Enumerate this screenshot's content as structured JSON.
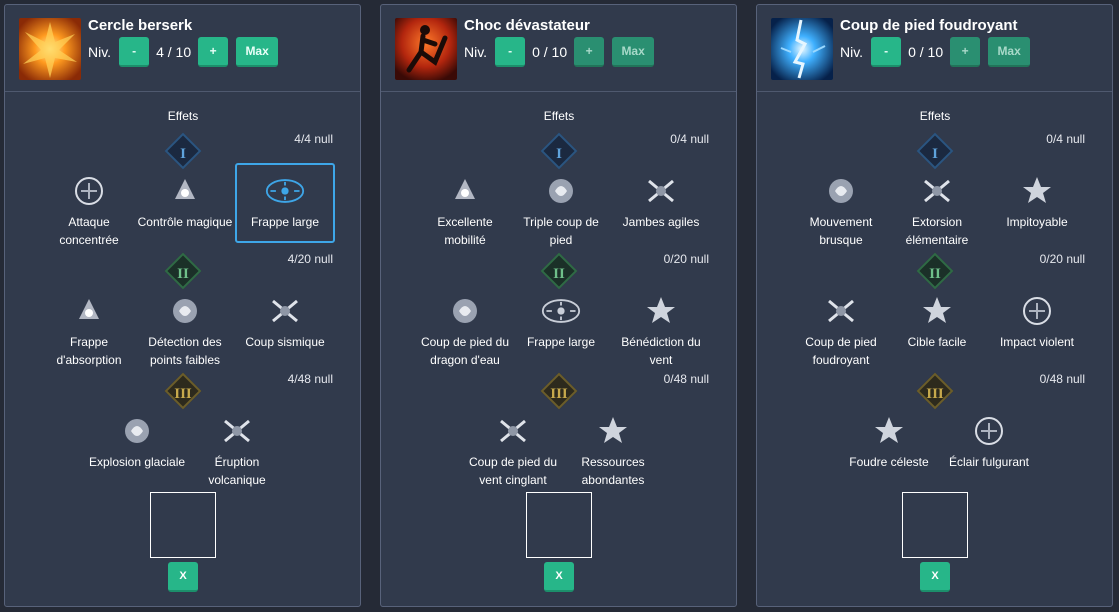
{
  "panels": [
    {
      "title": "Cercle berserk",
      "level_label": "Niv.",
      "level_value": "4 / 10",
      "minus_label": "-",
      "plus_label": "+",
      "max_label": "Max",
      "effects_label": "Effets",
      "icon": "fire-burst-icon",
      "tiers": [
        {
          "numeral": "I",
          "count": "4/4 null",
          "nodes": [
            {
              "lines": [
                "Attaque",
                "concentrée"
              ],
              "icon": "concentrated-attack-icon"
            },
            {
              "lines": [
                "Contrôle magique"
              ],
              "icon": "magic-control-icon"
            },
            {
              "lines": [
                "Frappe large"
              ],
              "icon": "wide-strike-icon",
              "selected": true
            }
          ]
        },
        {
          "numeral": "II",
          "count": "4/20 null",
          "nodes": [
            {
              "lines": [
                "Frappe",
                "d'absorption"
              ],
              "icon": "absorption-strike-icon"
            },
            {
              "lines": [
                "Détection des",
                "points faibles"
              ],
              "icon": "weak-point-detection-icon"
            },
            {
              "lines": [
                "Coup sismique"
              ],
              "icon": "seismic-blow-icon"
            }
          ]
        },
        {
          "numeral": "III",
          "count": "4/48 null",
          "nodes": [
            {
              "lines": [
                "Explosion glaciale"
              ],
              "icon": "glacial-explosion-icon"
            },
            {
              "lines": [
                "Éruption",
                "volcanique"
              ],
              "icon": "volcanic-eruption-icon"
            }
          ]
        }
      ],
      "close_label": "X"
    },
    {
      "title": "Choc dévastateur",
      "level_label": "Niv.",
      "level_value": "0 / 10",
      "minus_label": "-",
      "plus_label": "+",
      "max_label": "Max",
      "effects_label": "Effets",
      "icon": "kick-silhouette-icon",
      "tiers": [
        {
          "numeral": "I",
          "count": "0/4 null",
          "nodes": [
            {
              "lines": [
                "Excellente",
                "mobilité"
              ],
              "icon": "excellent-mobility-icon"
            },
            {
              "lines": [
                "Triple coup de",
                "pied"
              ],
              "icon": "triple-kick-icon"
            },
            {
              "lines": [
                "Jambes agiles"
              ],
              "icon": "agile-legs-icon"
            }
          ]
        },
        {
          "numeral": "II",
          "count": "0/20 null",
          "nodes": [
            {
              "lines": [
                "Coup de pied du",
                "dragon d'eau"
              ],
              "icon": "water-dragon-kick-icon"
            },
            {
              "lines": [
                "Frappe large"
              ],
              "icon": "wide-strike-icon"
            },
            {
              "lines": [
                "Bénédiction du",
                "vent"
              ],
              "icon": "wind-blessing-icon"
            }
          ]
        },
        {
          "numeral": "III",
          "count": "0/48 null",
          "nodes": [
            {
              "lines": [
                "Coup de pied du",
                "vent cinglant"
              ],
              "icon": "biting-wind-kick-icon"
            },
            {
              "lines": [
                "Ressources",
                "abondantes"
              ],
              "icon": "abundant-resources-icon"
            }
          ]
        }
      ],
      "close_label": "X"
    },
    {
      "title": "Coup de pied foudroyant",
      "level_label": "Niv.",
      "level_value": "0 / 10",
      "minus_label": "-",
      "plus_label": "+",
      "max_label": "Max",
      "effects_label": "Effets",
      "icon": "lightning-kick-icon",
      "tiers": [
        {
          "numeral": "I",
          "count": "0/4 null",
          "nodes": [
            {
              "lines": [
                "Mouvement",
                "brusque"
              ],
              "icon": "sudden-movement-icon"
            },
            {
              "lines": [
                "Extorsion",
                "élémentaire"
              ],
              "icon": "elemental-extortion-icon"
            },
            {
              "lines": [
                "Impitoyable"
              ],
              "icon": "ruthless-icon"
            }
          ]
        },
        {
          "numeral": "II",
          "count": "0/20 null",
          "nodes": [
            {
              "lines": [
                "Coup de pied",
                "foudroyant"
              ],
              "icon": "lightning-kick-small-icon"
            },
            {
              "lines": [
                "Cible facile"
              ],
              "icon": "easy-target-icon"
            },
            {
              "lines": [
                "Impact violent"
              ],
              "icon": "violent-impact-icon"
            }
          ]
        },
        {
          "numeral": "III",
          "count": "0/48 null",
          "nodes": [
            {
              "lines": [
                "Foudre céleste"
              ],
              "icon": "celestial-lightning-icon"
            },
            {
              "lines": [
                "Éclair fulgurant"
              ],
              "icon": "dazzling-flash-icon"
            }
          ]
        }
      ],
      "close_label": "X"
    }
  ],
  "colors": {
    "background": "#252a36",
    "panel": "#313a4c",
    "button": "#27b689",
    "selected_border": "#3ea6e8",
    "tier1": "#5fa3dc",
    "tier2": "#6fc08a",
    "tier3": "#c7a94c"
  }
}
